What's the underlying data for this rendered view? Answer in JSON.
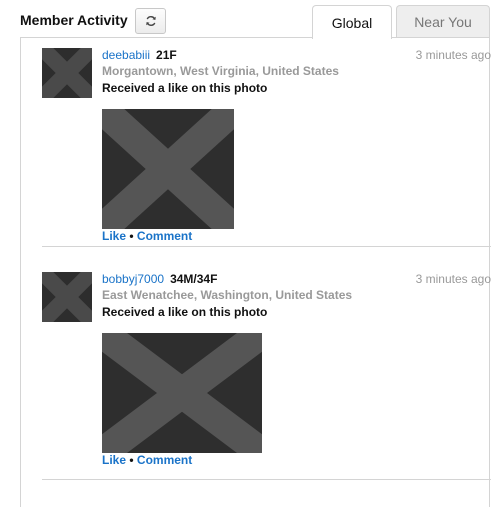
{
  "header": {
    "title": "Member Activity",
    "refresh_icon": "refresh-icon"
  },
  "tabs": [
    {
      "label": "Global",
      "active": true
    },
    {
      "label": "Near You",
      "active": false
    }
  ],
  "feed": [
    {
      "username": "deebabiii",
      "demographic": "21F",
      "time": "3 minutes ago",
      "location": "Morgantown, West Virginia, United States",
      "action": "Received a like on this photo",
      "like_label": "Like",
      "separator": "•",
      "comment_label": "Comment"
    },
    {
      "username": "bobbyj7000",
      "demographic": "34M/34F",
      "time": "3 minutes ago",
      "location": "East Wenatchee, Washington, United States",
      "action": "Received a like on this photo",
      "like_label": "Like",
      "separator": "•",
      "comment_label": "Comment"
    }
  ],
  "colors": {
    "link": "#1a73c8",
    "muted": "#999999",
    "border": "#d4d4d4"
  }
}
